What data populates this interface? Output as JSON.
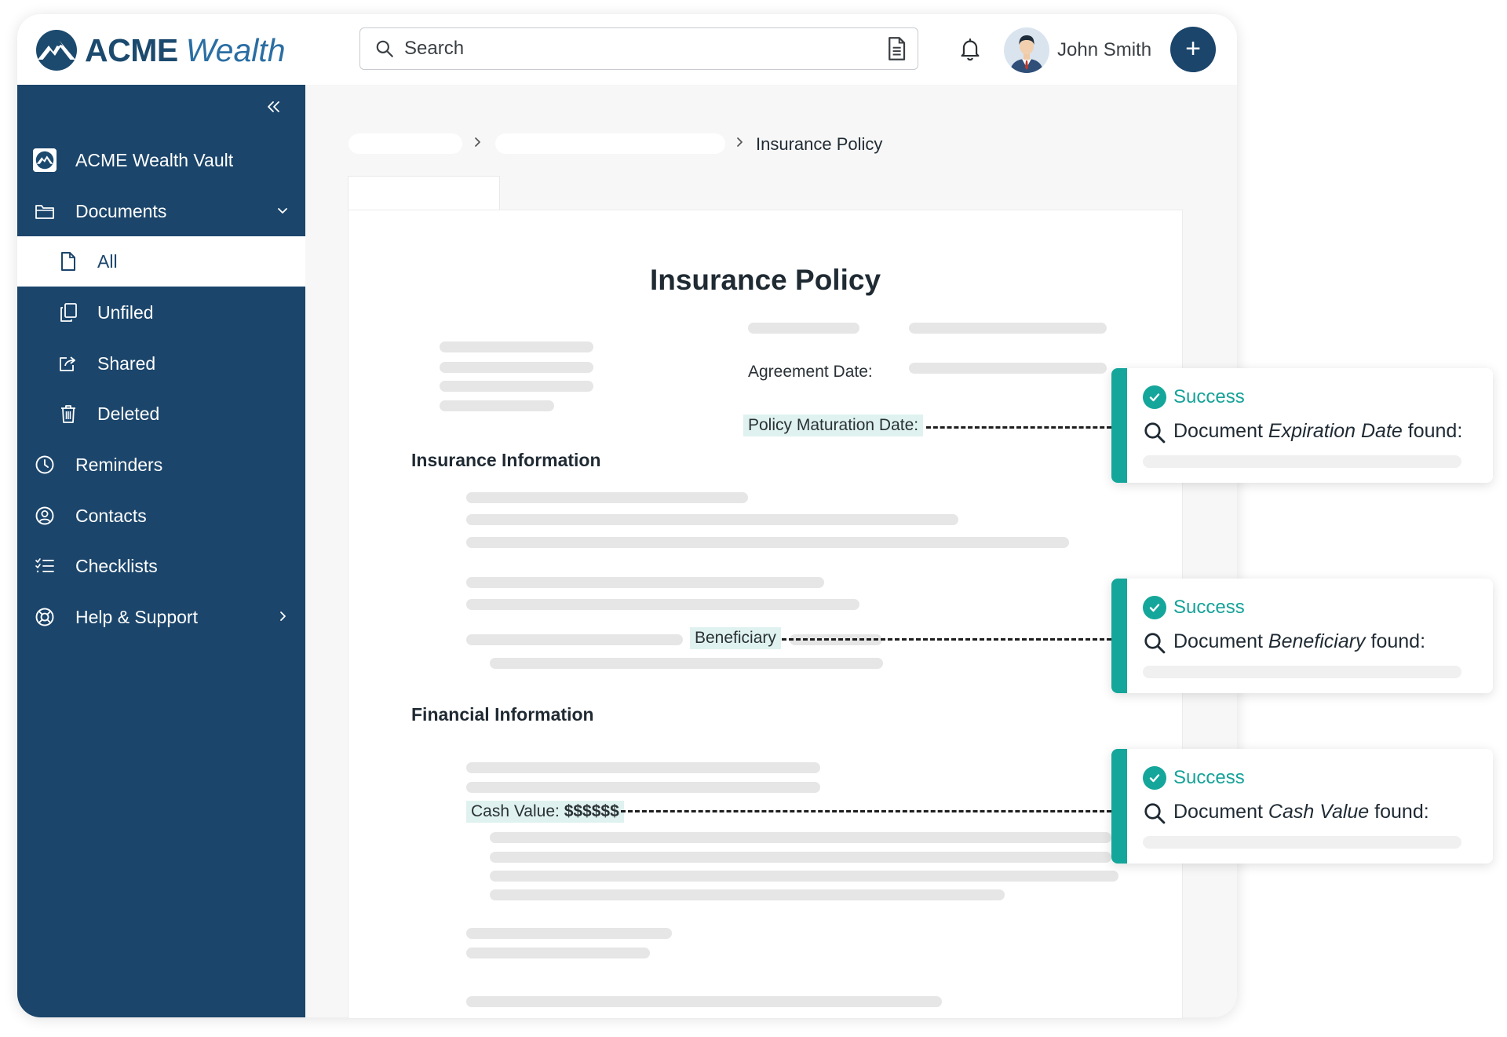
{
  "app": {
    "logo_primary": "ACME",
    "logo_secondary": "Wealth"
  },
  "header": {
    "search_placeholder": "Search",
    "user_name": "John Smith",
    "add_label": "+"
  },
  "sidebar": {
    "items": [
      {
        "label": "ACME Wealth Vault",
        "icon": "vault-logo-icon"
      },
      {
        "label": "Documents",
        "icon": "folder-icon",
        "chevron": "chevron-down-icon"
      },
      {
        "label": "All",
        "icon": "file-icon",
        "active": true
      },
      {
        "label": "Unfiled",
        "icon": "copy-icon"
      },
      {
        "label": "Shared",
        "icon": "share-icon"
      },
      {
        "label": "Deleted",
        "icon": "trash-icon"
      },
      {
        "label": "Reminders",
        "icon": "clock-icon"
      },
      {
        "label": "Contacts",
        "icon": "user-circle-icon"
      },
      {
        "label": "Checklists",
        "icon": "checklist-icon"
      },
      {
        "label": "Help & Support",
        "icon": "lifebuoy-icon",
        "chevron": "chevron-right-icon"
      }
    ]
  },
  "breadcrumb": {
    "current": "Insurance Policy"
  },
  "document": {
    "title": "Insurance Policy",
    "agreement_label": "Agreement Date:",
    "maturation_label": "Policy Maturation Date:",
    "insurance_heading": "Insurance Information",
    "beneficiary_label": "Beneficiary",
    "financial_heading": "Financial Information",
    "cash_label": "Cash Value: ",
    "cash_value": "$$$$$$"
  },
  "toasts": [
    {
      "status": "Success",
      "prefix": "Document ",
      "field": "Expiration Date",
      "suffix": " found:"
    },
    {
      "status": "Success",
      "prefix": "Document ",
      "field": "Beneficiary",
      "suffix": " found:"
    },
    {
      "status": "Success",
      "prefix": "Document ",
      "field": "Cash Value",
      "suffix": " found:"
    }
  ],
  "colors": {
    "brand_navy": "#1b456b",
    "success_teal": "#14a69a",
    "highlight": "#dff2ef"
  }
}
